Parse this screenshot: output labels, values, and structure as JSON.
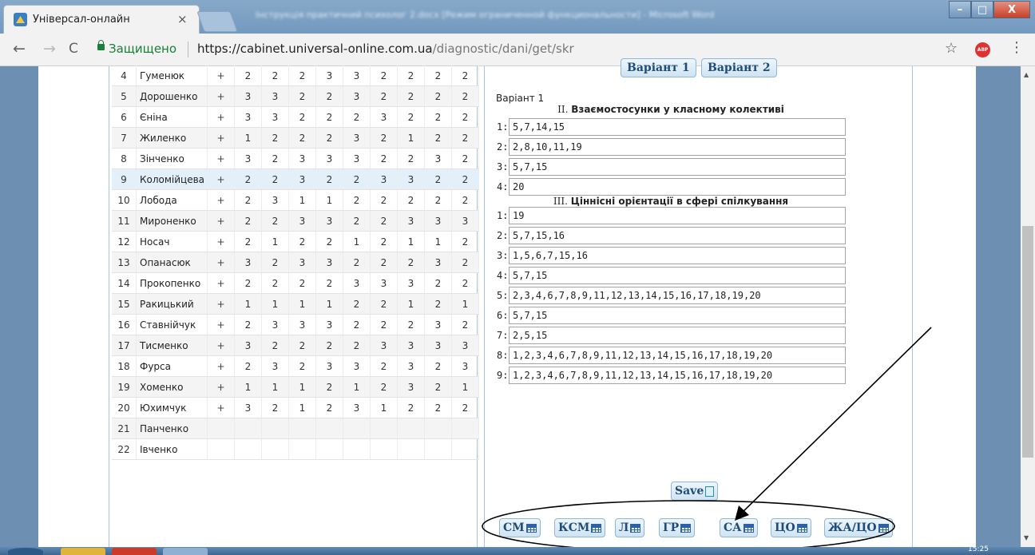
{
  "browser": {
    "tab_title": "Універсал-онлайн",
    "tab_close": "×",
    "background_window_title": "Інструкція практичний психолог 2.docx [Режим ограниченной функциональности] - Microsoft Word",
    "secure_label": "Защищено",
    "url_host": "https://cabinet.universal-online.com.ua",
    "url_path": "/diagnostic/dani/get/skr",
    "back": "←",
    "forward": "→",
    "reload": "C",
    "star": "☆",
    "abp": "ABP",
    "menu": "⋮",
    "win_min": "–",
    "win_max": "□",
    "win_close": "X"
  },
  "students": [
    {
      "num": "4",
      "name": "Гуменюк",
      "mark": "+",
      "scores": [
        "2",
        "2",
        "2",
        "3",
        "3",
        "2",
        "2",
        "2",
        "2"
      ]
    },
    {
      "num": "5",
      "name": "Дорошенко",
      "mark": "+",
      "scores": [
        "3",
        "3",
        "2",
        "2",
        "3",
        "2",
        "2",
        "2",
        "2"
      ]
    },
    {
      "num": "6",
      "name": "Єніна",
      "mark": "+",
      "scores": [
        "3",
        "3",
        "2",
        "2",
        "2",
        "3",
        "2",
        "2",
        "2"
      ]
    },
    {
      "num": "7",
      "name": "Жиленко",
      "mark": "+",
      "scores": [
        "1",
        "2",
        "2",
        "2",
        "3",
        "2",
        "1",
        "2",
        "2"
      ]
    },
    {
      "num": "8",
      "name": "Зінченко",
      "mark": "+",
      "scores": [
        "3",
        "2",
        "3",
        "3",
        "3",
        "2",
        "2",
        "3",
        "2"
      ]
    },
    {
      "num": "9",
      "name": "Коломійцева",
      "mark": "+",
      "scores": [
        "2",
        "2",
        "3",
        "2",
        "2",
        "3",
        "3",
        "2",
        "2"
      ]
    },
    {
      "num": "10",
      "name": "Лобода",
      "mark": "+",
      "scores": [
        "2",
        "3",
        "1",
        "1",
        "2",
        "2",
        "2",
        "2",
        "2"
      ]
    },
    {
      "num": "11",
      "name": "Мироненко",
      "mark": "+",
      "scores": [
        "2",
        "2",
        "3",
        "3",
        "2",
        "2",
        "3",
        "3",
        "3"
      ]
    },
    {
      "num": "12",
      "name": "Носач",
      "mark": "+",
      "scores": [
        "2",
        "1",
        "2",
        "2",
        "1",
        "2",
        "1",
        "1",
        "2"
      ]
    },
    {
      "num": "13",
      "name": "Опанасюк",
      "mark": "+",
      "scores": [
        "3",
        "2",
        "3",
        "3",
        "2",
        "2",
        "2",
        "3",
        "2"
      ]
    },
    {
      "num": "14",
      "name": "Прокопенко",
      "mark": "+",
      "scores": [
        "2",
        "2",
        "2",
        "2",
        "3",
        "3",
        "3",
        "2",
        "2"
      ]
    },
    {
      "num": "15",
      "name": "Ракицький",
      "mark": "+",
      "scores": [
        "1",
        "1",
        "1",
        "1",
        "2",
        "2",
        "1",
        "2",
        "1"
      ]
    },
    {
      "num": "16",
      "name": "Ставнійчук",
      "mark": "+",
      "scores": [
        "2",
        "3",
        "3",
        "3",
        "2",
        "2",
        "2",
        "3",
        "2"
      ]
    },
    {
      "num": "17",
      "name": "Тисменко",
      "mark": "+",
      "scores": [
        "3",
        "2",
        "2",
        "2",
        "2",
        "3",
        "3",
        "3",
        "3"
      ]
    },
    {
      "num": "18",
      "name": "Фурса",
      "mark": "+",
      "scores": [
        "2",
        "3",
        "2",
        "3",
        "3",
        "2",
        "3",
        "2",
        "3"
      ]
    },
    {
      "num": "19",
      "name": "Хоменко",
      "mark": "+",
      "scores": [
        "1",
        "1",
        "1",
        "2",
        "1",
        "2",
        "3",
        "2",
        "1"
      ]
    },
    {
      "num": "20",
      "name": "Юхимчук",
      "mark": "+",
      "scores": [
        "3",
        "2",
        "1",
        "2",
        "3",
        "1",
        "2",
        "2",
        "2"
      ]
    },
    {
      "num": "21",
      "name": "Панченко",
      "mark": "",
      "scores": [
        "",
        "",
        "",
        "",
        "",
        "",
        "",
        "",
        ""
      ]
    },
    {
      "num": "22",
      "name": "Івченко",
      "mark": "",
      "scores": [
        "",
        "",
        "",
        "",
        "",
        "",
        "",
        "",
        ""
      ]
    }
  ],
  "variants": {
    "button1": "Варіант 1",
    "button2": "Варіант 2",
    "current_label": "Варіант 1"
  },
  "section2": {
    "roman": "II.",
    "title": "Взаємостосунки у класному колективі",
    "answers": [
      {
        "label": "1:",
        "value": "5,7,14,15"
      },
      {
        "label": "2:",
        "value": "2,8,10,11,19"
      },
      {
        "label": "3:",
        "value": "5,7,15"
      },
      {
        "label": "4:",
        "value": "20"
      }
    ]
  },
  "section3": {
    "roman": "III.",
    "title": "Ціннісні орієнтації в сфері спілкування",
    "answers": [
      {
        "label": "1:",
        "value": "19"
      },
      {
        "label": "2:",
        "value": "5,7,15,16"
      },
      {
        "label": "3:",
        "value": "1,5,6,7,15,16"
      },
      {
        "label": "4:",
        "value": "5,7,15"
      },
      {
        "label": "5:",
        "value": "2,3,4,6,7,8,9,11,12,13,14,15,16,17,18,19,20"
      },
      {
        "label": "6:",
        "value": "5,7,15"
      },
      {
        "label": "7:",
        "value": "2,5,15"
      },
      {
        "label": "8:",
        "value": "1,2,3,4,6,7,8,9,11,12,13,14,15,16,17,18,19,20"
      },
      {
        "label": "9:",
        "value": "1,2,3,4,6,7,8,9,11,12,13,14,15,16,17,18,19,20"
      }
    ]
  },
  "save_label": "Save",
  "report_buttons": [
    "СМ",
    "КСМ",
    "Л",
    "ГР",
    "СА",
    "ЦО",
    "ЖА/ЦО"
  ],
  "taskbar": {
    "clock": "15:25"
  },
  "colors": {
    "accent": "#1f4d7a",
    "secure": "#188038",
    "highlight_row": "#e3f0fa"
  }
}
